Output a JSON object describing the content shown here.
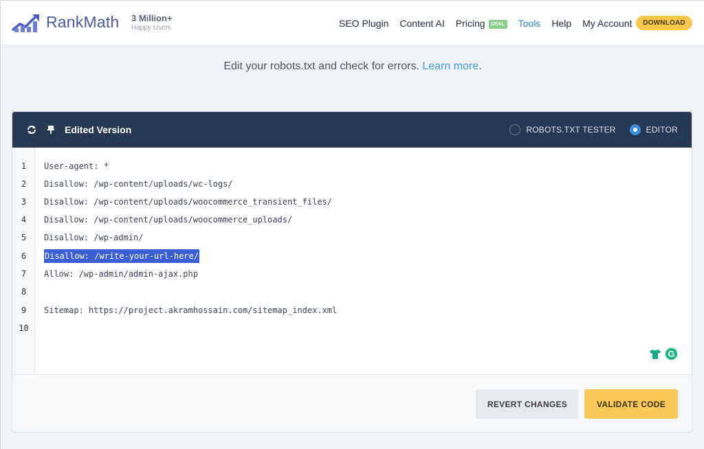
{
  "header": {
    "brand": "RankMath",
    "users_count": "3 Million+",
    "users_label": "Happy Users",
    "nav": [
      {
        "label": "SEO Plugin",
        "active": false
      },
      {
        "label": "Content AI",
        "active": false
      },
      {
        "label": "Pricing",
        "active": false,
        "badge": "DEAL"
      },
      {
        "label": "Tools",
        "active": true
      },
      {
        "label": "Help",
        "active": false
      },
      {
        "label": "My Account",
        "active": false
      }
    ],
    "download_label": "DOWNLOAD"
  },
  "intro": {
    "text": "Edit your robots.txt and check for errors.",
    "link": "Learn more",
    "suffix": "."
  },
  "panel": {
    "title": "Edited Version",
    "modes": [
      {
        "label": "ROBOTS.TXT TESTER",
        "selected": false
      },
      {
        "label": "EDITOR",
        "selected": true
      }
    ],
    "lines": [
      {
        "no": "1",
        "text": "User-agent: *"
      },
      {
        "no": "2",
        "text": "Disallow: /wp-content/uploads/wc-logs/"
      },
      {
        "no": "3",
        "text": "Disallow: /wp-content/uploads/woocommerce_transient_files/"
      },
      {
        "no": "4",
        "text": "Disallow: /wp-content/uploads/woocommerce_uploads/"
      },
      {
        "no": "5",
        "text": "Disallow: /wp-admin/"
      },
      {
        "no": "6",
        "text": "Disallow: /write-your-url-here/"
      },
      {
        "no": "7",
        "text": "Allow: /wp-admin/admin-ajax.php"
      },
      {
        "no": "8",
        "text": ""
      },
      {
        "no": "9",
        "text": "Sitemap: https://project.akramhossain.com/sitemap_index.xml"
      },
      {
        "no": "10",
        "text": ""
      }
    ],
    "selected_line": 6,
    "revert_label": "REVERT CHANGES",
    "validate_label": "VALIDATE CODE"
  },
  "colors": {
    "accent": "#3b8fe0",
    "panel_header": "#253a52",
    "download": "#f7c84b",
    "validate": "#f8c95b",
    "selection": "#3b5fd4"
  }
}
